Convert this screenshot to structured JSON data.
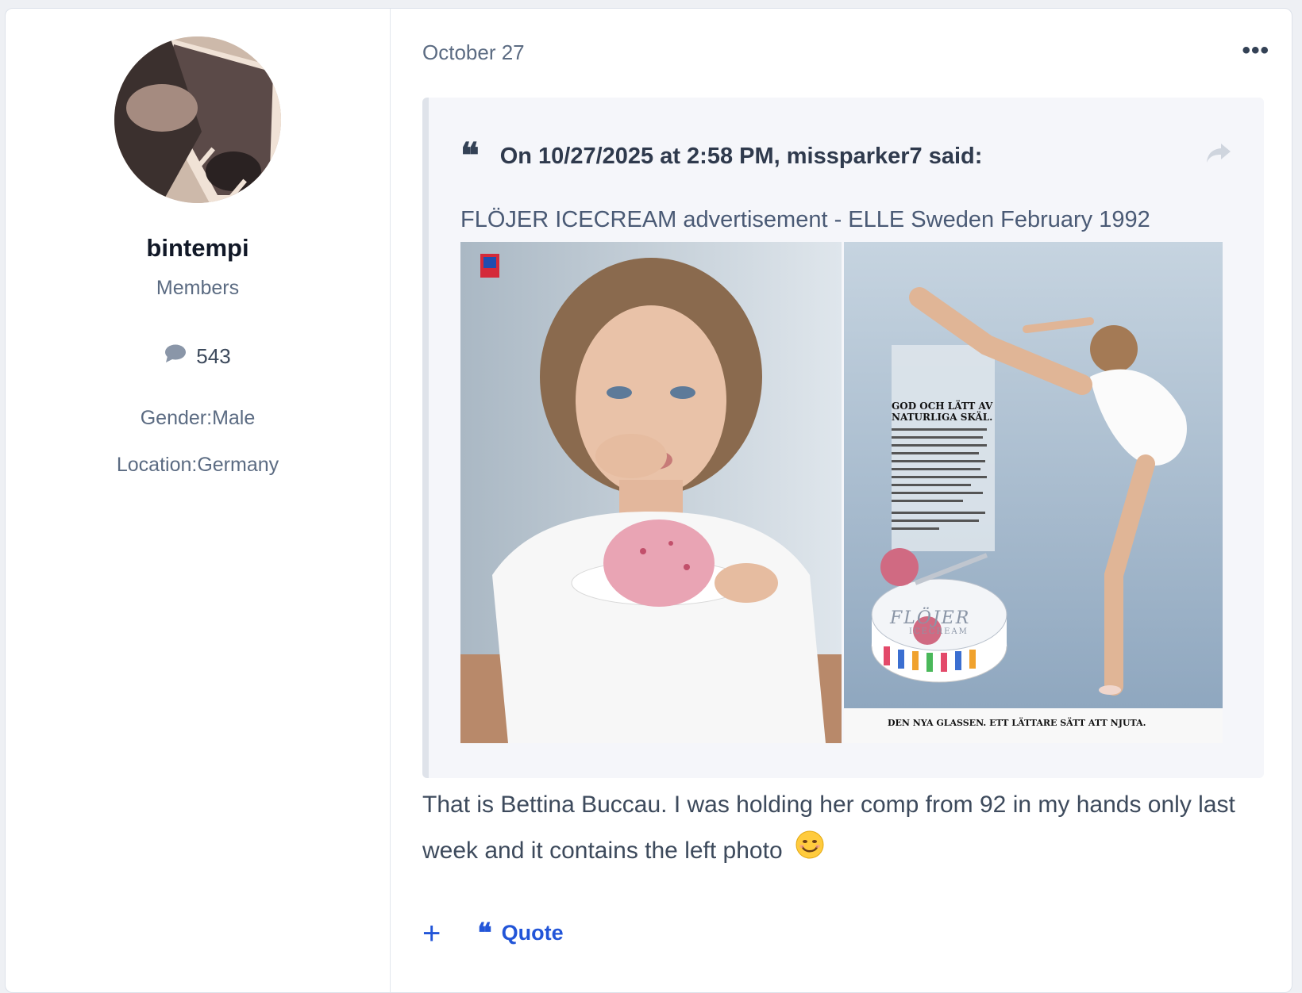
{
  "author": {
    "name": "bintempi",
    "group": "Members",
    "post_count": "543",
    "gender": "Gender:Male",
    "location": "Location:Germany"
  },
  "post": {
    "date": "October 27",
    "more_label": "•••",
    "quote": {
      "header": "On 10/27/2025 at 2:58 PM, missparker7 said:",
      "caption": "FLÖJER ICECREAM advertisement - ELLE Sweden February 1992",
      "ad": {
        "headline": "GOD OCH LÄTT AV NATURLIGA SKÄL.",
        "brand": "FLÖJER",
        "brand_sub": "ICECREAM",
        "tagline": "DEN NYA GLASSEN. ETT LÄTTARE SÄTT ATT NJUTA."
      }
    },
    "reply_text": "That is Bettina Buccau. I was holding her comp from 92 in my hands only last week and it contains the left photo"
  },
  "actions": {
    "plus_label": "+",
    "quote_label": "Quote"
  },
  "icons": [
    "comment-icon",
    "more-icon",
    "quote-mark-icon",
    "share-icon",
    "smiley-emoji",
    "plus-icon"
  ],
  "colors": {
    "accent": "#2255d8",
    "text": "#3d4a5c",
    "muted": "#5b6b82",
    "quote_bg": "#f5f6fa"
  }
}
